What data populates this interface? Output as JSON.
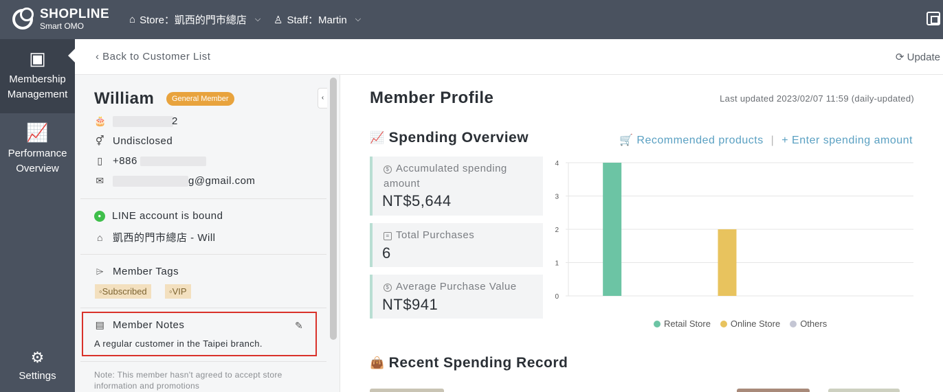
{
  "topbar": {
    "brand": "SHOPLINE",
    "brand_sub": "Smart OMO",
    "store": "Store：凱西的門市總店",
    "staff": "Staff：Martin"
  },
  "sidebar": {
    "items": [
      {
        "label": "Membership Management",
        "icon": "member-card-icon"
      },
      {
        "label": "Performance Overview",
        "icon": "chart-icon"
      },
      {
        "label": "Settings",
        "icon": "gear-icon"
      }
    ]
  },
  "subheader": {
    "back": "Back to Customer List",
    "update": "Update"
  },
  "member": {
    "name": "William",
    "level": "General Member",
    "birthday": "2",
    "gender": "Undisclosed",
    "phone": "+886",
    "email_suffix": "g@gmail.com",
    "line_status": "LINE account is bound",
    "store_line": "凱西的門市總店 - Will",
    "tags_title": "Member Tags",
    "tags": [
      "Subscribed",
      "VIP"
    ],
    "notes_title": "Member Notes",
    "notes": "A regular customer in the Taipei branch.",
    "consent_note": "Note: This member hasn't agreed to accept store information and promotions"
  },
  "profile": {
    "title": "Member Profile",
    "last_updated": "Last updated 2023/02/07 11:59 (daily-updated)",
    "spending_title": "Spending Overview",
    "recommended": "Recommended products",
    "enter_amount": "+ Enter spending amount",
    "cards": [
      {
        "label": "Accumulated spending amount",
        "value": "NT$5,644"
      },
      {
        "label": "Total Purchases",
        "value": "6"
      },
      {
        "label": "Average Purchase Value",
        "value": "NT$941"
      }
    ],
    "recent_title": "Recent Spending Record"
  },
  "colors": {
    "retail": "#6cc4a4",
    "online": "#e8c35e",
    "others": "#c4c6d4",
    "accent": "#5aa0c2",
    "badge": "#e8a33d"
  },
  "chart_data": {
    "type": "bar",
    "categories": [
      "Retail Store",
      "Online Store",
      "Others"
    ],
    "values": [
      4,
      2,
      0
    ],
    "yticks": [
      "4",
      "3",
      "2",
      "1",
      "0"
    ],
    "ylim": [
      0,
      4
    ],
    "legend": [
      "Retail Store",
      "Online Store",
      "Others"
    ]
  }
}
